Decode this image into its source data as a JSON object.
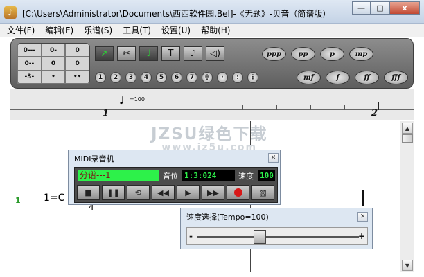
{
  "window": {
    "title": "[C:\\Users\\Administrator\\Documents\\西西软件园.Bel]-《无题》-贝音（简谱版）",
    "buttons": [
      "—",
      "□",
      "x"
    ]
  },
  "menu": [
    "文件(F)",
    "编辑(E)",
    "乐谱(S)",
    "工具(T)",
    "设置(U)",
    "帮助(H)"
  ],
  "toolbar": {
    "durations": [
      "0---",
      "0-",
      "0",
      "0--",
      "0",
      "0",
      "-3-",
      "•",
      "••"
    ],
    "tools": [
      "pointer-icon",
      "scissors-icon",
      "note-insert-icon",
      "text-icon",
      "lyrics-icon",
      "speaker-icon"
    ],
    "numbers": [
      "1",
      "2",
      "3",
      "4",
      "5",
      "6",
      "7",
      "≑",
      "·",
      ":",
      "⋮"
    ],
    "dynamics_top": [
      "ppp",
      "pp",
      "p",
      "mp"
    ],
    "dynamics_bottom": [
      "mf",
      "f",
      "ff",
      "fff"
    ]
  },
  "ruler": {
    "tempo": "=100",
    "measures": [
      "1",
      "2"
    ]
  },
  "score": {
    "track_number": "1",
    "key": "1=C",
    "time_denominator": "4"
  },
  "watermark": {
    "line1": "JZSU绿色下载",
    "line2": "www.jz5u.com"
  },
  "midi": {
    "title": "MIDI录音机",
    "track_label": "分谱---1",
    "position_label": "音位",
    "position_value": "1:3:024",
    "speed_label": "速度",
    "speed_value": "100"
  },
  "speed_dialog": {
    "title": "速度选择(Tempo=100)",
    "tempo": 100,
    "min_label": "-",
    "max_label": "+"
  },
  "colors": {
    "lcd_green": "#2df14a",
    "record_red": "#d81818",
    "track_green": "#2a9a2a"
  }
}
